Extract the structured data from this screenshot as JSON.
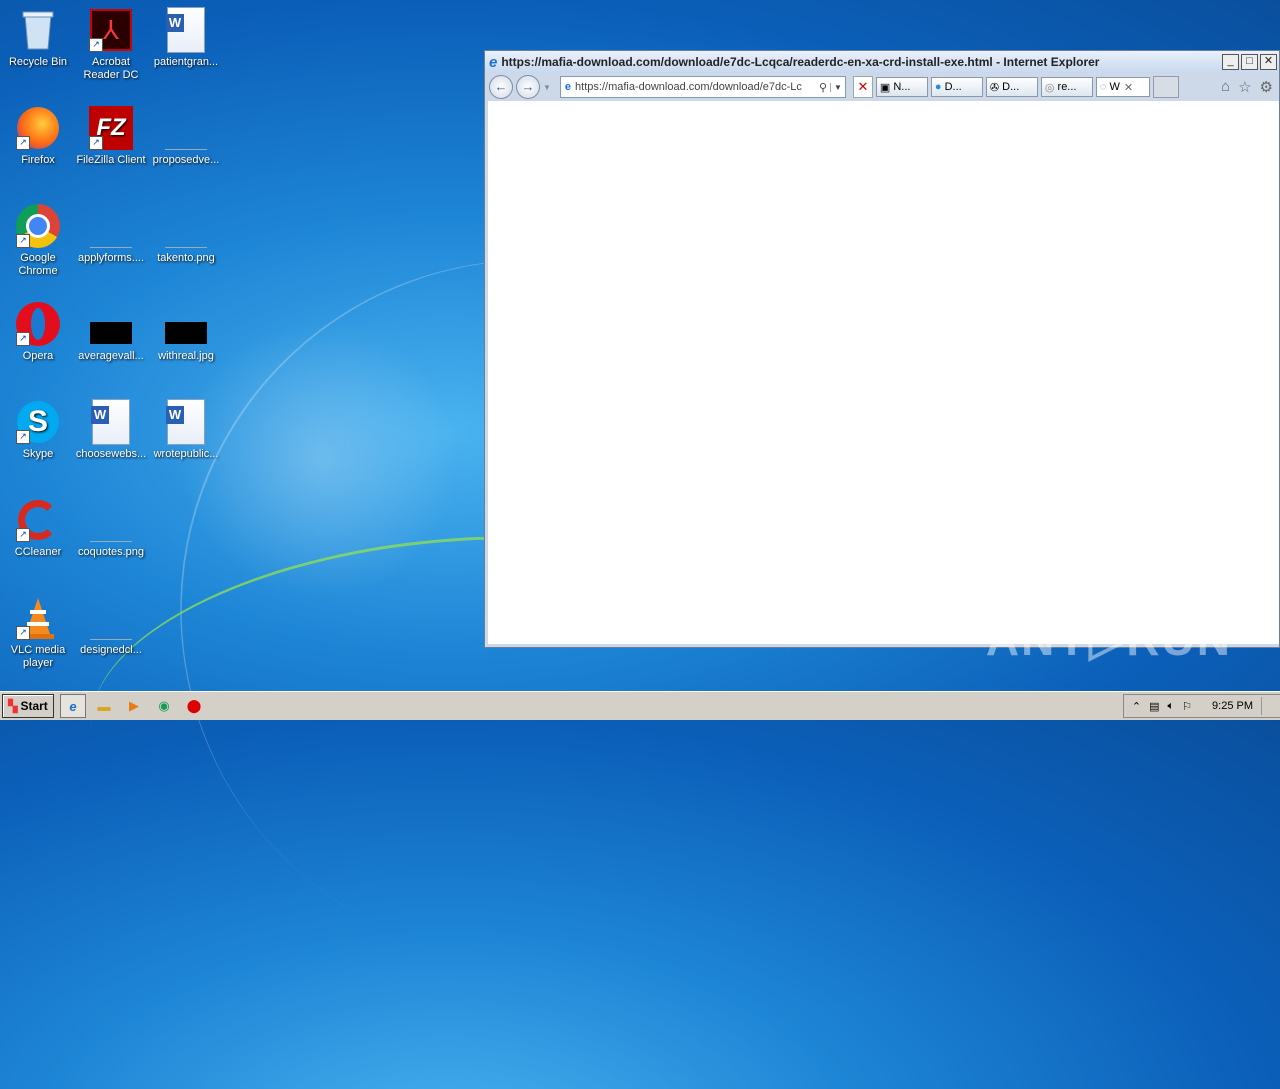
{
  "desktop": {
    "icons": [
      {
        "label": "Recycle Bin"
      },
      {
        "label": "Acrobat Reader DC"
      },
      {
        "label": "patientgran..."
      },
      {
        "label": "Firefox"
      },
      {
        "label": "FileZilla Client"
      },
      {
        "label": "proposedve..."
      },
      {
        "label": "Google Chrome"
      },
      {
        "label": "applyforms...."
      },
      {
        "label": "takento.png"
      },
      {
        "label": "Opera"
      },
      {
        "label": "averagevall..."
      },
      {
        "label": "withreal.jpg"
      },
      {
        "label": "Skype"
      },
      {
        "label": "choosewebs..."
      },
      {
        "label": "wrotepublic..."
      },
      {
        "label": "CCleaner"
      },
      {
        "label": "coquotes.png"
      },
      {
        "label": "VLC media player"
      },
      {
        "label": "designedcl..."
      }
    ]
  },
  "ie": {
    "title": "https://mafia-download.com/download/e7dc-Lcqca/readerdc-en-xa-crd-install-exe.html - Internet Explorer",
    "address": "https://mafia-download.com/download/e7dc-Lc",
    "tabs": [
      {
        "label": "N..."
      },
      {
        "label": "D..."
      },
      {
        "label": "D..."
      },
      {
        "label": "re..."
      },
      {
        "label": "W"
      }
    ]
  },
  "watermark": "ANY▷RUN",
  "taskbar": {
    "start_label": "Start",
    "clock": "9:25 PM"
  }
}
